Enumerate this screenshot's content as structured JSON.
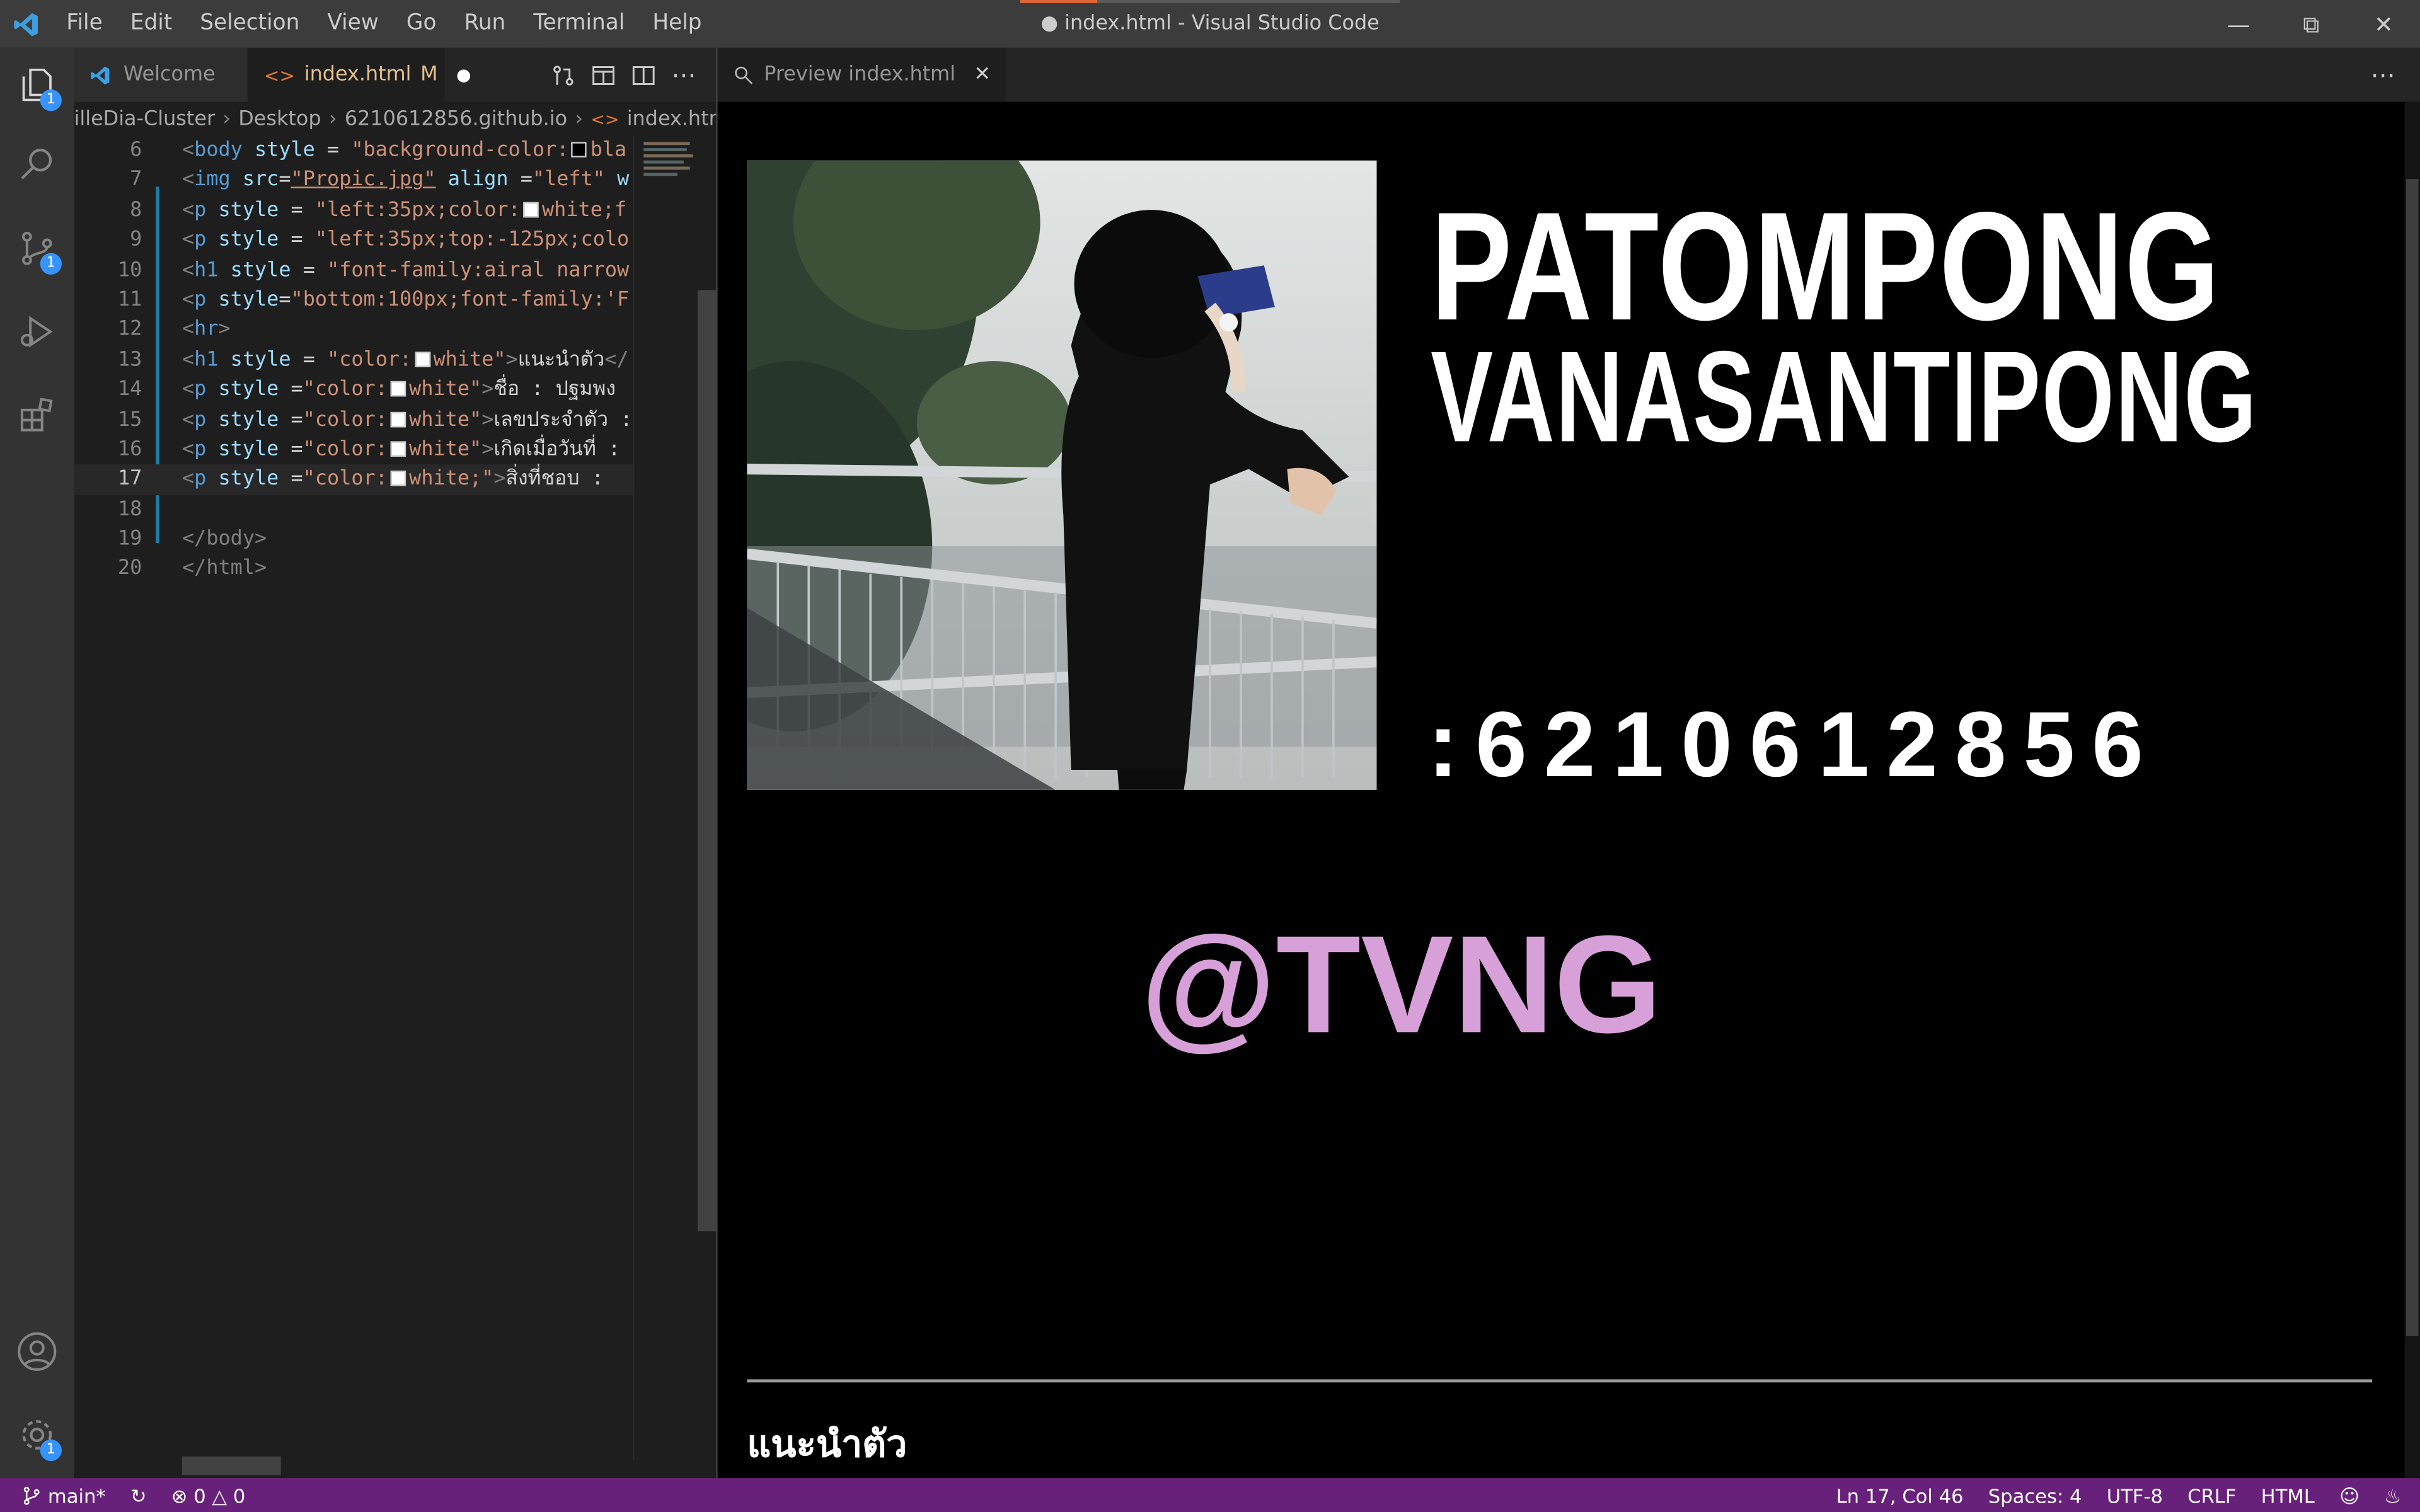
{
  "window": {
    "title": "● index.html - Visual Studio Code",
    "menu": [
      "File",
      "Edit",
      "Selection",
      "View",
      "Go",
      "Run",
      "Terminal",
      "Help"
    ]
  },
  "activity_bar": {
    "explorer_badge": "1",
    "scm_badge": "1",
    "settings_badge": "1"
  },
  "tabs": {
    "welcome": "Welcome",
    "index": "index.html",
    "index_status": "M",
    "preview": "Preview index.html"
  },
  "breadcrumb": {
    "items": [
      "illeDia-Cluster",
      "Desktop",
      "6210612856.github.io",
      "index.html"
    ]
  },
  "code": {
    "line_numbers": [
      "6",
      "7",
      "8",
      "9",
      "10",
      "11",
      "12",
      "13",
      "14",
      "15",
      "16",
      "17",
      "18",
      "19",
      "20"
    ],
    "l6": {
      "a": "style",
      "op": " = ",
      "v": "\"background-color:",
      "v2": "bla"
    },
    "l7": {
      "a": "src",
      "v": "\"Propic.jpg\"",
      "a2": "align",
      "v2": "\"left\"",
      "a3": "w"
    },
    "l8": {
      "a": "style",
      "op": " = ",
      "v": "\"left:35px;color:",
      "v2": "white;f"
    },
    "l9": {
      "a": "style",
      "op": " = ",
      "v": "\"left:35px;top:-125px;colo"
    },
    "l10": {
      "a": "style",
      "op": " = ",
      "v": "\"font-family:airal narrow"
    },
    "l11": {
      "a": "style",
      "v": "\"bottom:100px;font-family:'F"
    },
    "l13": {
      "a": "style",
      "op": " = ",
      "v": "\"color:",
      "v2": "white\"",
      "t": "แนะนำตัว"
    },
    "l14": {
      "a": "style",
      "op": " =",
      "v": "\"color:",
      "v2": "white\"",
      "t": "ชื่อ : ปฐมพง"
    },
    "l15": {
      "a": "style",
      "op": " =",
      "v": "\"color:",
      "v2": "white\"",
      "t": "เลขประจำตัว :"
    },
    "l16": {
      "a": "style",
      "op": " =",
      "v": "\"color:",
      "v2": "white\"",
      "t": "เกิดเมื่อวันที่ :"
    },
    "l17": {
      "a": "style",
      "op": " =",
      "v": "\"color:",
      "v2": "white;\"",
      "t": "สิ่งที่ชอบ : "
    },
    "tags": {
      "body": "body",
      "img": "img",
      "p": "p",
      "h1": "h1",
      "hr": "hr",
      "html": "html"
    }
  },
  "preview": {
    "name_line1": "PATOMPONG",
    "name_line2": "VANASANTIPONG",
    "student_id": ":6210612856",
    "handle": "@TVNG",
    "section_heading": "แนะนำตัว"
  },
  "status": {
    "branch": "main*",
    "errors": "0",
    "warnings": "0",
    "position": "Ln 17, Col 46",
    "spaces": "Spaces: 4",
    "encoding": "UTF-8",
    "eol": "CRLF",
    "language": "HTML"
  },
  "colors": {
    "status_bar": "#68217a",
    "handle_text": "#d8a0d8",
    "modified_tab": "#e2c08d",
    "badge": "#3794ff"
  }
}
